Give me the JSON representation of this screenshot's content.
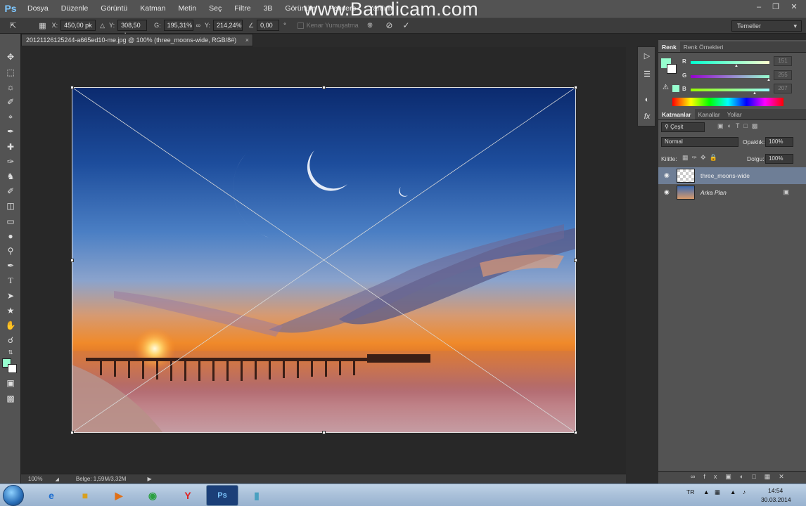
{
  "app": {
    "logo": "Ps"
  },
  "menu": [
    "Dosya",
    "Düzenle",
    "Görüntü",
    "Katman",
    "Metin",
    "Seç",
    "Filtre",
    "3B",
    "Görünüm",
    "Pencere",
    "Yardım"
  ],
  "watermark": "www.Bandicam.com",
  "options": {
    "x_label": "X:",
    "x_value": "450,00 pk",
    "y_label": "Y:",
    "y_value": "308,50 pk",
    "w_label": "G:",
    "w_value": "195,31%",
    "h_label": "Y:",
    "h_value": "214,24%",
    "angle_value": "0,00",
    "angle_unit": "°",
    "antialias_label": "Kenar Yumuşatma",
    "workspace": "Temeller"
  },
  "document": {
    "tab_title": "20121126125244-a665ed10-me.jpg @ 100% (three_moons-wide, RGB/8#)",
    "close": "×"
  },
  "status": {
    "zoom": "100%",
    "doc_info": "Belge: 1,59M/3,32M"
  },
  "color_panel": {
    "tabs": [
      "Renk",
      "Renk Örnekleri"
    ],
    "r_label": "R",
    "r_value": "151",
    "g_label": "G",
    "g_value": "255",
    "b_label": "B",
    "b_value": "207",
    "foreground": "#97ffcf",
    "background": "#ffffff"
  },
  "layers_panel": {
    "tabs": [
      "Katmanlar",
      "Kanallar",
      "Yollar"
    ],
    "filter_label": "Çeşit",
    "blend_mode": "Normal",
    "opacity_label": "Opaklık:",
    "opacity_value": "100%",
    "lock_label": "Kilitle:",
    "fill_label": "Dolgu:",
    "fill_value": "100%",
    "layers": [
      {
        "name": "three_moons-wide",
        "selected": true
      },
      {
        "name": "Arka Plan",
        "selected": false
      }
    ]
  },
  "taskbar": {
    "language": "TR",
    "time": "14:54",
    "date": "30.03.2014"
  }
}
